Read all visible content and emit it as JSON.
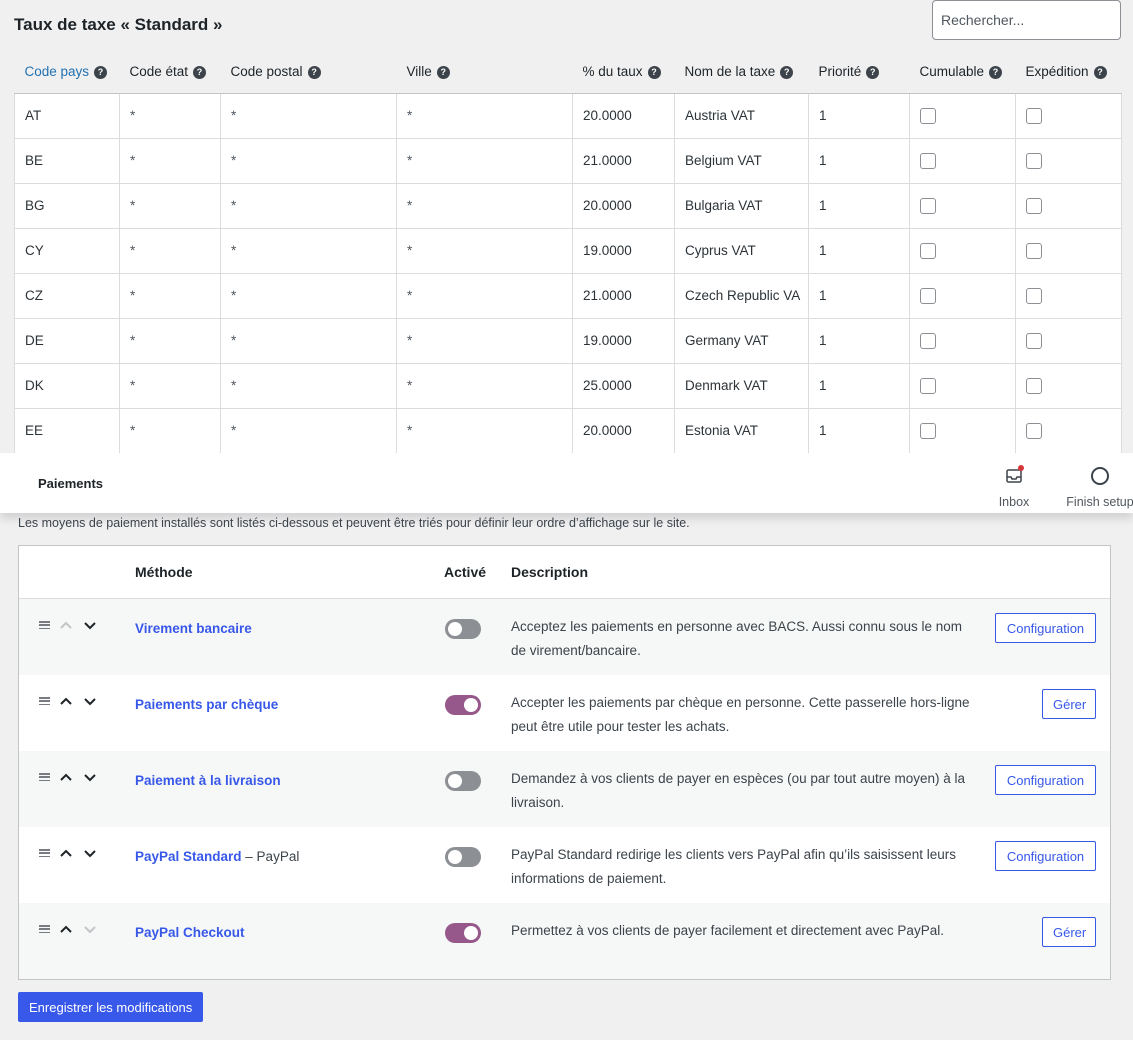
{
  "tax": {
    "title": "Taux de taxe « Standard »",
    "search_placeholder": "Rechercher...",
    "columns": [
      "Code pays",
      "Code état",
      "Code postal",
      "Ville",
      "% du taux",
      "Nom de la taxe",
      "Priorité",
      "Cumulable",
      "Expédition"
    ],
    "rows": [
      {
        "country": "AT",
        "state": "*",
        "postcode": "*",
        "city": "*",
        "rate": "20.0000",
        "name": "Austria VAT",
        "priority": "1",
        "compound": false,
        "shipping": false
      },
      {
        "country": "BE",
        "state": "*",
        "postcode": "*",
        "city": "*",
        "rate": "21.0000",
        "name": "Belgium VAT",
        "priority": "1",
        "compound": false,
        "shipping": false
      },
      {
        "country": "BG",
        "state": "*",
        "postcode": "*",
        "city": "*",
        "rate": "20.0000",
        "name": "Bulgaria VAT",
        "priority": "1",
        "compound": false,
        "shipping": false
      },
      {
        "country": "CY",
        "state": "*",
        "postcode": "*",
        "city": "*",
        "rate": "19.0000",
        "name": "Cyprus VAT",
        "priority": "1",
        "compound": false,
        "shipping": false
      },
      {
        "country": "CZ",
        "state": "*",
        "postcode": "*",
        "city": "*",
        "rate": "21.0000",
        "name": "Czech Republic VA",
        "priority": "1",
        "compound": false,
        "shipping": false
      },
      {
        "country": "DE",
        "state": "*",
        "postcode": "*",
        "city": "*",
        "rate": "19.0000",
        "name": "Germany VAT",
        "priority": "1",
        "compound": false,
        "shipping": false
      },
      {
        "country": "DK",
        "state": "*",
        "postcode": "*",
        "city": "*",
        "rate": "25.0000",
        "name": "Denmark VAT",
        "priority": "1",
        "compound": false,
        "shipping": false
      },
      {
        "country": "EE",
        "state": "*",
        "postcode": "*",
        "city": "*",
        "rate": "20.0000",
        "name": "Estonia VAT",
        "priority": "1",
        "compound": false,
        "shipping": false
      }
    ]
  },
  "header": {
    "title": "Paiements",
    "inbox_label": "Inbox",
    "finish_setup_label": "Finish setup"
  },
  "payments": {
    "intro": "Les moyens de paiement installés sont listés ci-dessous et peuvent être triés pour définir leur ordre d’affichage sur le site.",
    "col_method": "Méthode",
    "col_enabled": "Activé",
    "col_description": "Description",
    "methods": [
      {
        "name": "Virement bancaire",
        "sub": "",
        "enabled": false,
        "description": "Acceptez les paiements en personne avec BACS. Aussi connu sous le nom de virement/bancaire.",
        "action": "Configuration",
        "up_enabled": false,
        "down_enabled": true
      },
      {
        "name": "Paiements par chèque",
        "sub": "",
        "enabled": true,
        "description": "Accepter les paiements par chèque en personne. Cette passerelle hors-ligne peut être utile pour tester les achats.",
        "action": "Gérer",
        "up_enabled": true,
        "down_enabled": true
      },
      {
        "name": "Paiement à la livraison",
        "sub": "",
        "enabled": false,
        "description": "Demandez à vos clients de payer en espèces (ou par tout autre moyen) à la livraison.",
        "action": "Configuration",
        "up_enabled": true,
        "down_enabled": true
      },
      {
        "name": "PayPal Standard",
        "sub": " – PayPal",
        "enabled": false,
        "description": "PayPal Standard redirige les clients vers PayPal afin qu’ils saisissent leurs informations de paiement.",
        "action": "Configuration",
        "up_enabled": true,
        "down_enabled": true
      },
      {
        "name": "PayPal Checkout",
        "sub": "",
        "enabled": true,
        "description": "Permettez à vos clients de payer facilement et directement avec PayPal.",
        "action": "Gérer",
        "up_enabled": true,
        "down_enabled": false
      }
    ],
    "save_label": "Enregistrer les modifications"
  },
  "colors": {
    "link_blue": "#3858e9",
    "toggle_on": "#96588a",
    "toggle_off": "#8c8f94",
    "badge_red": "#d63638"
  },
  "icons": [
    "help-icon",
    "inbox-icon",
    "circle-icon",
    "drag-handle-icon",
    "chevron-up-icon",
    "chevron-down-icon"
  ]
}
